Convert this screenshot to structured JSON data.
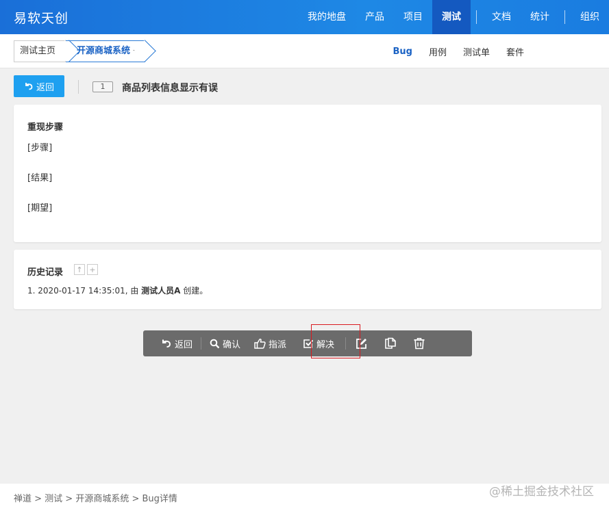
{
  "header": {
    "brand": "易软天创",
    "nav": [
      "我的地盘",
      "产品",
      "项目",
      "测试",
      "文档",
      "统计",
      "组织"
    ],
    "active_nav": "测试",
    "accent_color": "#1e88e5"
  },
  "subheader": {
    "crumb_home": "测试主页",
    "crumb_product": "开源商城系统",
    "tabs": [
      "Bug",
      "用例",
      "测试单",
      "套件"
    ],
    "active_tab": "Bug"
  },
  "title_row": {
    "back_label": "返回",
    "bug_id": "1",
    "bug_title": "商品列表信息显示有误"
  },
  "steps_panel": {
    "heading": "重现步骤",
    "lines": [
      "[步骤]",
      "[结果]",
      "[期望]"
    ]
  },
  "history_panel": {
    "heading": "历史记录",
    "entry_prefix": "1. 2020-01-17 14:35:01, 由 ",
    "entry_user": "测试人员A",
    "entry_suffix": " 创建。"
  },
  "toolbar": {
    "back": "返回",
    "confirm": "确认",
    "assign": "指派",
    "resolve": "解决"
  },
  "footer": {
    "crumbs": "禅道 > 测试 > 开源商城系统 > Bug详情",
    "watermark": "@稀土掘金技术社区"
  }
}
